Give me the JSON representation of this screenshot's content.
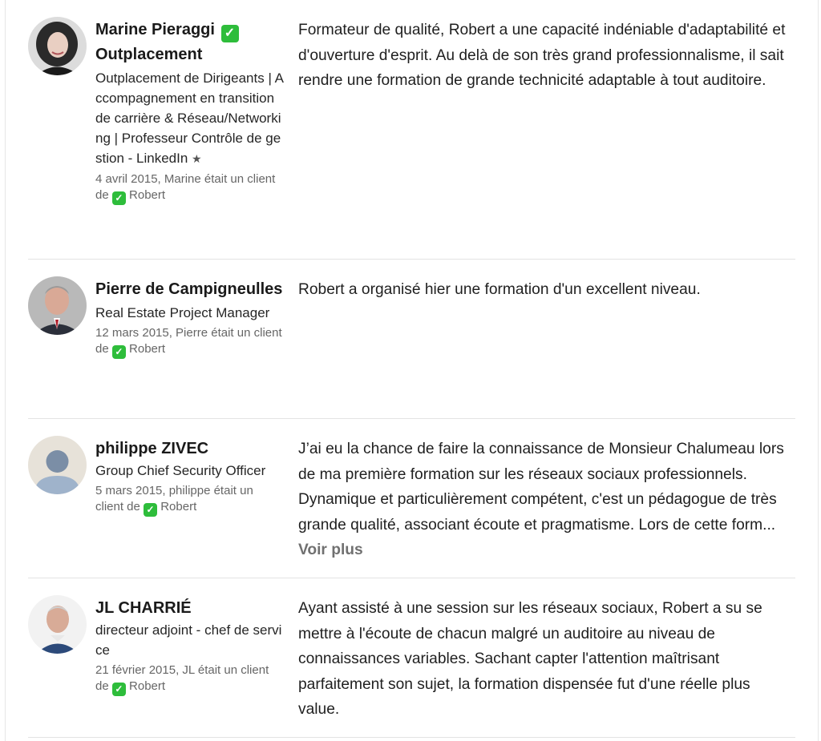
{
  "recommendations": [
    {
      "name": "Marine Pieraggi",
      "name_suffix": "Outplacement",
      "headline": "Outplacement de Dirigeants | Accompagnement en transition de carrière & Réseau/Networking | Professeur Contrôle de gestion - LinkedIn",
      "star": "★",
      "meta_prefix": "4 avril 2015, Marine était un client de",
      "meta_name": "Robert",
      "text": "Formateur de qualité, Robert a une capacité indéniable d'adaptabilité et d'ouverture d'esprit. Au delà de son très grand professionnalisme, il sait rendre une formation de grande technicité adaptable à tout auditoire."
    },
    {
      "name": "Pierre de Campigneulles",
      "headline": "Real Estate Project Manager",
      "meta_prefix": "12 mars 2015, Pierre était un client de",
      "meta_name": "Robert",
      "text": "Robert a organisé hier une formation d'un excellent niveau."
    },
    {
      "name": "philippe ZIVEC",
      "headline": "Group Chief Security Officer",
      "meta_prefix": "5 mars 2015, philippe était un client de",
      "meta_name": "Robert",
      "text": "J’ai eu la chance de faire la connaissance de Monsieur Chalumeau lors de ma première formation sur les réseaux sociaux professionnels. Dynamique et particulièrement compétent, c'est un pédagogue de très grande qualité, associant écoute et pragmatisme. Lors de cette form...",
      "more_label": "Voir plus"
    },
    {
      "name": "JL CHARRIÉ",
      "headline": "directeur adjoint - chef de service",
      "meta_prefix": "21 février 2015, JL était un client de",
      "meta_name": "Robert",
      "text": "Ayant assisté à une session sur les réseaux sociaux, Robert a su se mettre à l'écoute de chacun malgré un auditoire au niveau de connaissances variables. Sachant capter l'attention maîtrisant parfaitement son sujet, la formation dispensée fut d'une réelle plus value."
    }
  ],
  "icons": {
    "verified": "check-box-icon",
    "check_color": "#2ebd3b"
  },
  "colors": {
    "link_more": "#707070",
    "meta_text": "#666666",
    "divider": "#e3e3e3"
  }
}
